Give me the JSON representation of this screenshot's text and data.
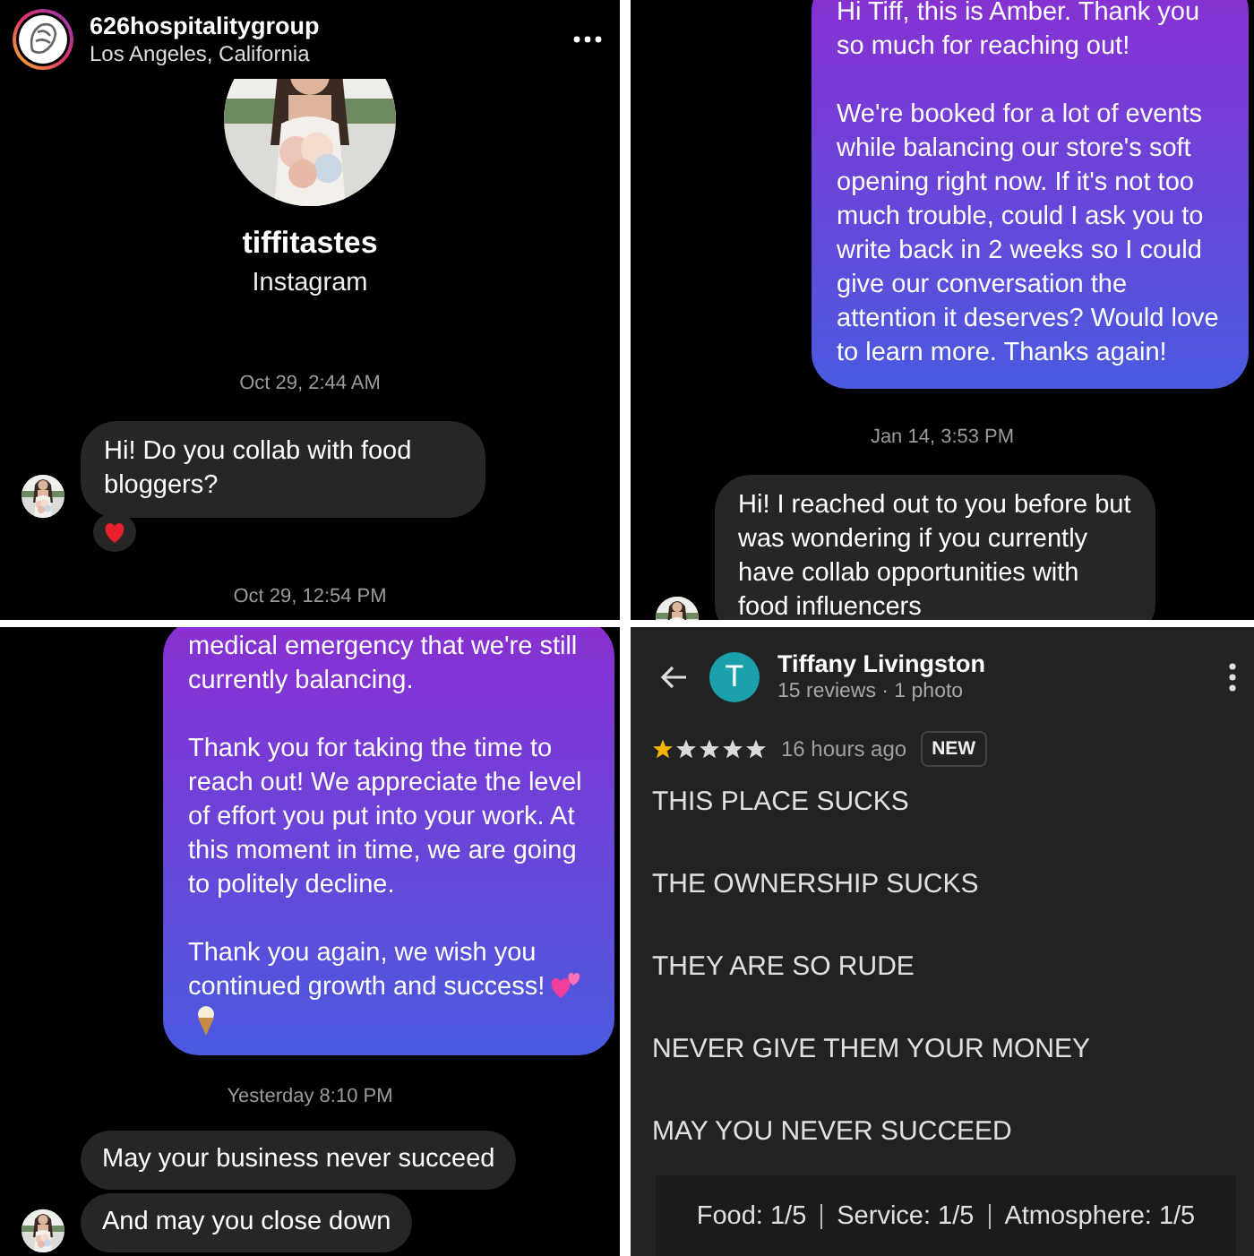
{
  "panels": [
    {
      "kind": "dm",
      "header": {
        "name": "626hospitalitygroup",
        "location": "Los Angeles, California"
      },
      "items": [
        {
          "kind": "profile",
          "name": "tiffitastes",
          "subtitle": "Instagram"
        },
        {
          "kind": "timestamp",
          "text": "Oct 29, 2:44 AM"
        },
        {
          "kind": "incoming",
          "paragraphs": [
            "Hi! Do you collab with food bloggers?"
          ],
          "avatar": true,
          "reacted": true
        },
        {
          "kind": "timestamp",
          "text": "Oct 29, 12:54 PM"
        }
      ]
    },
    {
      "kind": "dm",
      "items": [
        {
          "kind": "outgoing",
          "paragraphs": [
            "Hi Tiff, this is Amber. Thank you so much for reaching out!",
            "We're booked for a lot of events while balancing our store's soft opening right now. If it's not too much trouble, could I ask you to write back in 2 weeks so I could give our conversation the attention it deserves? Would love to learn more. Thanks again!"
          ],
          "emoji": false
        },
        {
          "kind": "timestamp",
          "text": "Jan 14, 3:53 PM"
        },
        {
          "kind": "incoming",
          "paragraphs": [
            "Hi! I reached out to you before but was wondering if you currently have collab opportunities with food influencers"
          ],
          "avatar": true
        }
      ]
    },
    {
      "kind": "dm",
      "items": [
        {
          "kind": "outgoing",
          "paragraphs": [
            "medical emergency that we're still currently balancing.",
            "Thank you for taking the time to reach out! We appreciate the level of effort you put into your work. At this moment in time, we are going to politely decline.",
            "Thank you again, we wish you continued growth and success!"
          ],
          "emoji": true
        },
        {
          "kind": "timestamp",
          "text": "Yesterday 8:10 PM"
        },
        {
          "kind": "incoming",
          "paragraphs": [
            "May your business never succeed"
          ],
          "avatar": false
        },
        {
          "kind": "incoming",
          "paragraphs": [
            "And may you close down"
          ],
          "avatar": true
        }
      ]
    },
    {
      "kind": "review",
      "reviewer": {
        "initial": "T",
        "name": "Tiffany Livingston",
        "meta": "15 reviews · 1 photo"
      },
      "stars": 1,
      "time": "16 hours ago",
      "badge": "NEW",
      "lines": [
        "THIS PLACE SUCKS",
        "THE OWNERSHIP SUCKS",
        "THEY ARE SO RUDE",
        "NEVER GIVE THEM YOUR MONEY",
        "MAY YOU NEVER SUCCEED"
      ],
      "ratings": [
        "Food: 1/5",
        "Service: 1/5",
        "Atmosphere: 1/5"
      ]
    }
  ]
}
